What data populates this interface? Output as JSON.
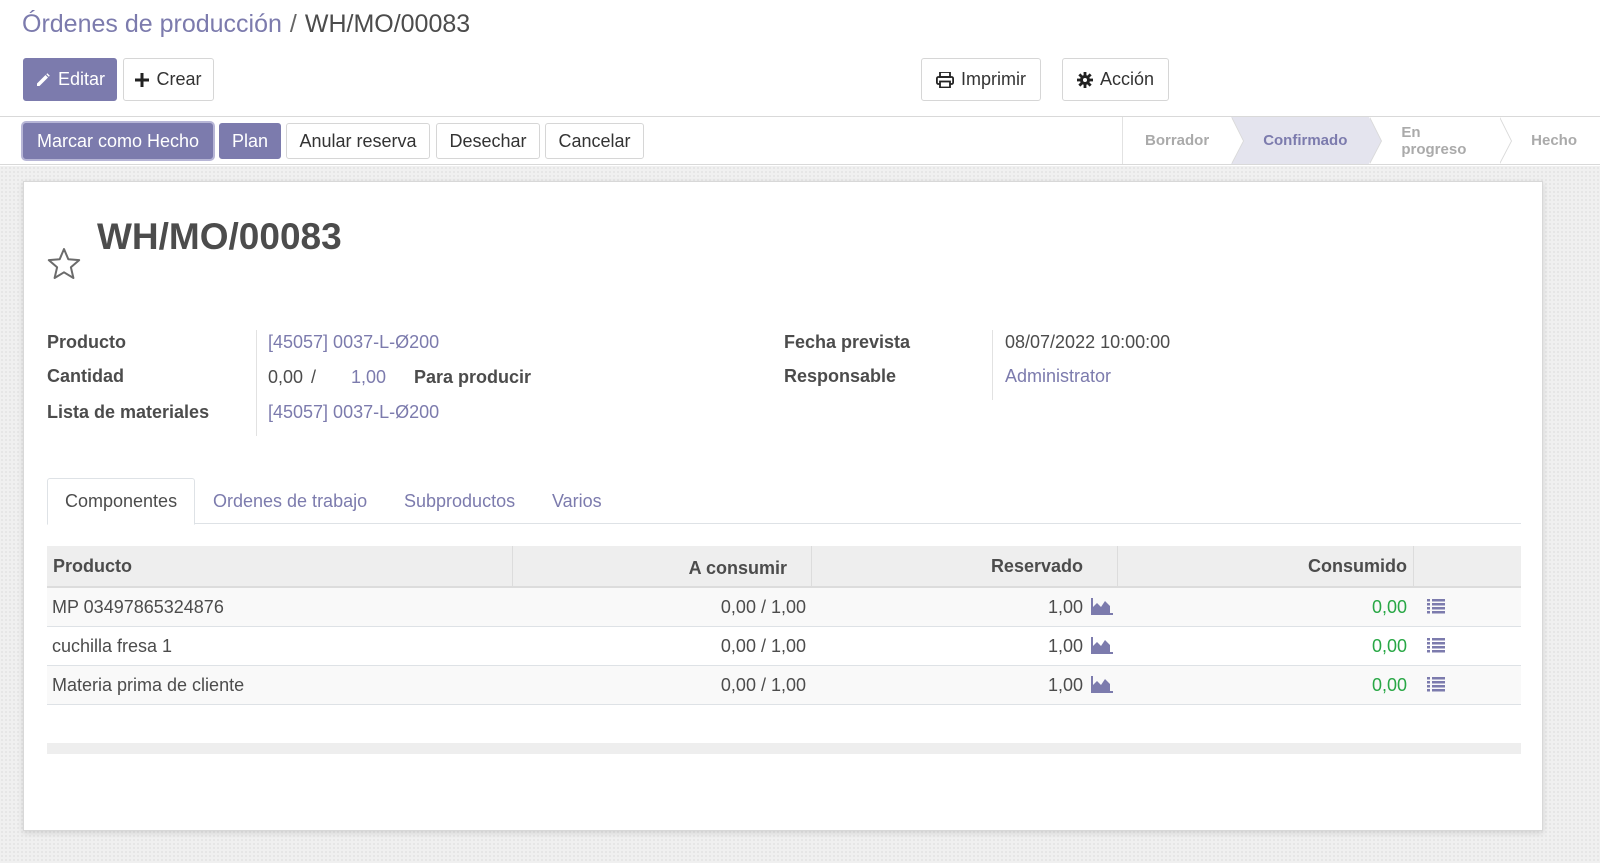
{
  "breadcrumb": {
    "parent": "Órdenes de producción",
    "separator": "/",
    "current": "WH/MO/00083"
  },
  "toolbar": {
    "edit_label": "Editar",
    "create_label": "Crear",
    "print_label": "Imprimir",
    "action_label": "Acción"
  },
  "actions": {
    "mark_done": "Marcar como Hecho",
    "plan": "Plan",
    "unreserve": "Anular reserva",
    "scrap": "Desechar",
    "cancel": "Cancelar"
  },
  "status": {
    "stages": [
      "Borrador",
      "Confirmado",
      "En progreso",
      "Hecho"
    ],
    "active": "Confirmado"
  },
  "record": {
    "title": "WH/MO/00083",
    "product_label": "Producto",
    "product_value": "[45057] 0037-L-Ø200",
    "quantity_label": "Cantidad",
    "quantity_produced": "0,00",
    "quantity_sep": "/",
    "quantity_total": "1,00",
    "quantity_suffix": "Para producir",
    "bom_label": "Lista de materiales",
    "bom_value": "[45057] 0037-L-Ø200",
    "date_label": "Fecha prevista",
    "date_value": "08/07/2022 10:00:00",
    "responsible_label": "Responsable",
    "responsible_value": "Administrator"
  },
  "tabs": [
    {
      "label": "Componentes"
    },
    {
      "label": "Ordenes de trabajo"
    },
    {
      "label": "Subproductos"
    },
    {
      "label": "Varios"
    }
  ],
  "table": {
    "headers": {
      "product": "Producto",
      "to_consume": "A consumir",
      "reserved": "Reservado",
      "consumed": "Consumido"
    },
    "rows": [
      {
        "product": "MP 03497865324876",
        "to_consume": "0,00 / 1,00",
        "reserved": "1,00",
        "consumed": "0,00"
      },
      {
        "product": "cuchilla fresa 1",
        "to_consume": "0,00 / 1,00",
        "reserved": "1,00",
        "consumed": "0,00"
      },
      {
        "product": "Materia prima de cliente",
        "to_consume": "0,00 / 1,00",
        "reserved": "1,00",
        "consumed": "0,00"
      }
    ]
  },
  "icons": {
    "edit": "pencil-icon",
    "create": "plus-icon",
    "print": "printer-icon",
    "action": "gear-icon",
    "favorite": "star-icon",
    "forecast": "area-chart-icon",
    "details": "list-icon"
  },
  "colors": {
    "primary": "#7c7bad",
    "active_stage_bg": "#e4e4ee",
    "consumed_text": "#28a745"
  }
}
